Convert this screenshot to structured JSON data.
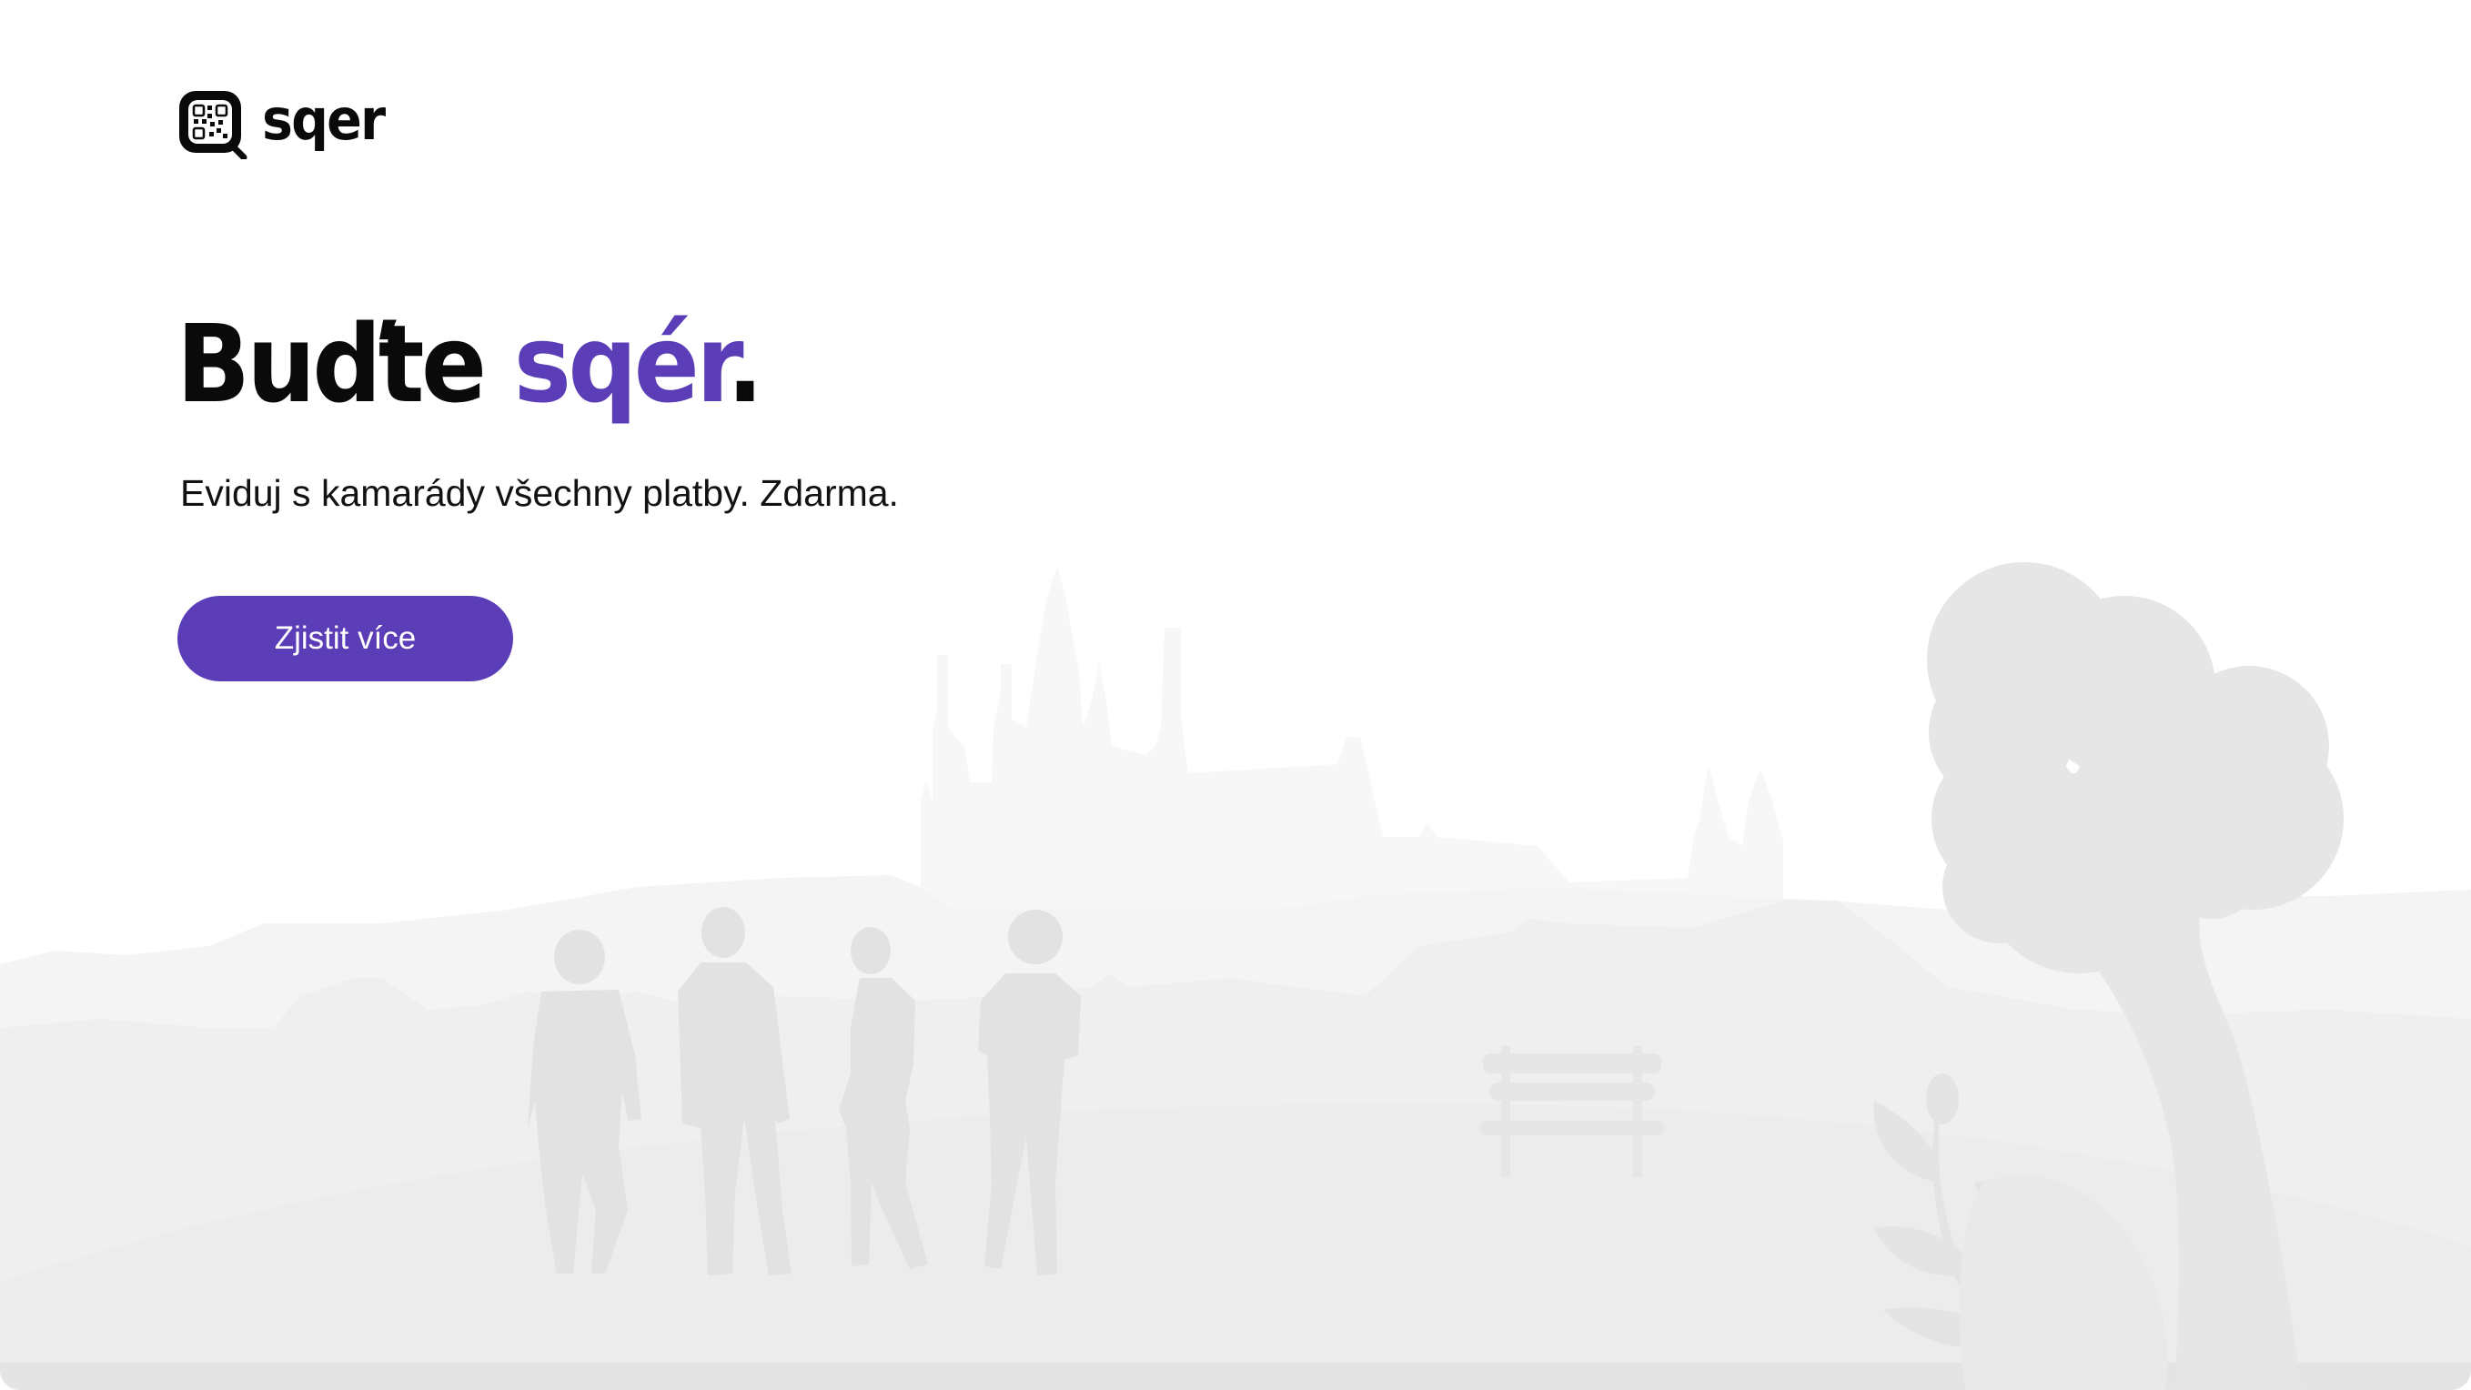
{
  "brand": {
    "name": "sqer",
    "logo_icon": "qr-code-logo-icon"
  },
  "hero": {
    "title_part1": "Buďte ",
    "title_accent": "sqér",
    "title_end": ".",
    "subtitle": "Eviduj s kamarády všechny platby. Zdarma.",
    "cta_label": "Zjistit více"
  },
  "colors": {
    "accent": "#5a3db7",
    "text": "#0a0a0a",
    "background": "#ffffff",
    "illustration": "#eaeaea"
  }
}
